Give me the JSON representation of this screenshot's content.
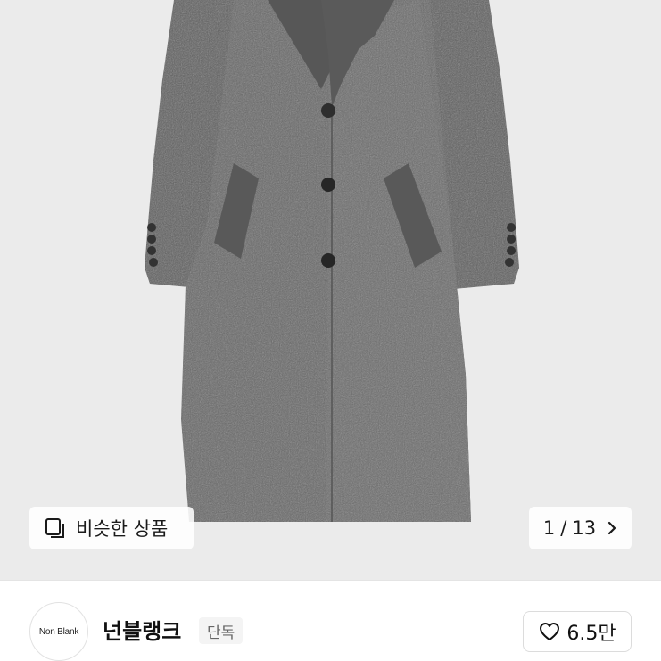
{
  "product": {
    "image_icon": "gray-wool-overcoat",
    "image_bg": "#ebebeb",
    "coat_color": "#656565"
  },
  "gallery": {
    "similar_label": "비슷한 상품",
    "similar_icon": "similar-products-icon",
    "current_page": "1",
    "separator": "/",
    "total_pages": "13",
    "next_icon": "chevron-right-icon"
  },
  "brand": {
    "logo_text": "Non Blank",
    "name": "넌블랭크",
    "badge": "단독",
    "like_icon": "heart-icon",
    "like_count": "6.5만"
  }
}
